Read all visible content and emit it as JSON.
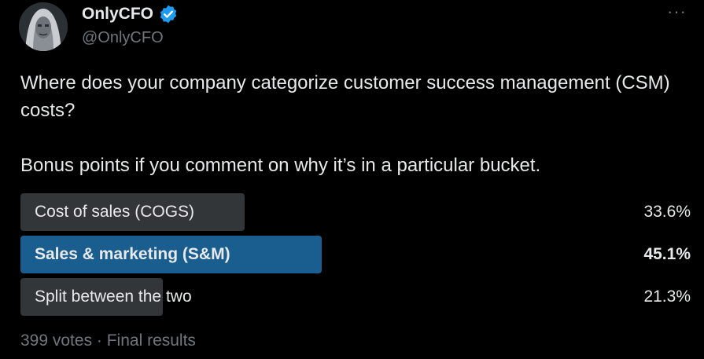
{
  "author": {
    "display_name": "OnlyCFO",
    "handle": "@OnlyCFO",
    "avatar_icon": "avatar-portrait",
    "verified_icon": "verified-badge-icon",
    "verified_color": "#1d9bf0"
  },
  "more_icon": "more-icon",
  "tweet": {
    "text": "Where does your company categorize customer success management (CSM) costs?\n\nBonus points if you comment on why it’s in a particular bucket."
  },
  "poll": {
    "options": [
      {
        "label": "Cost of sales (COGS)",
        "percent": "33.6%",
        "value": 33.6,
        "winner": false
      },
      {
        "label": "Sales & marketing (S&M)",
        "percent": "45.1%",
        "value": 45.1,
        "winner": true
      },
      {
        "label": "Split between the two",
        "percent": "21.3%",
        "value": 21.3,
        "winner": false
      }
    ],
    "footer": "399 votes · Final results"
  },
  "colors": {
    "background": "#000000",
    "text": "#e7e9ea",
    "muted": "#71767b",
    "bar": "#333639",
    "winner_bar": "#1a5d8f"
  }
}
